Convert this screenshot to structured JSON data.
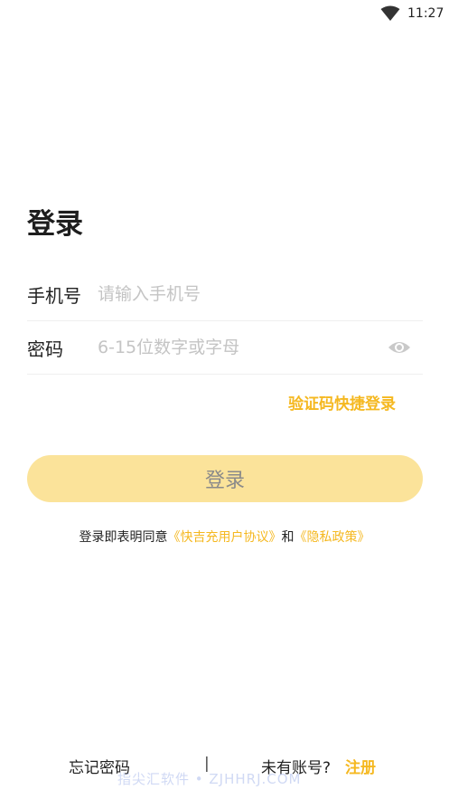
{
  "status_bar": {
    "time": "11:27"
  },
  "title": "登录",
  "phone": {
    "label": "手机号",
    "placeholder": "请输入手机号"
  },
  "password": {
    "label": "密码",
    "placeholder": "6-15位数字或字母"
  },
  "sms_login_label": "验证码快捷登录",
  "login_button_label": "登录",
  "agreement": {
    "prefix": "登录即表明同意",
    "user_agreement": "《快吉充用户协议》",
    "and": "和",
    "privacy_policy": "《隐私政策》"
  },
  "footer": {
    "forgot_password": "忘记密码",
    "divider": "|",
    "no_account": "未有账号?",
    "register": "注册"
  },
  "watermark": "指尖汇软件 • ZJHHRJ.COM",
  "colors": {
    "accent": "#f5b820",
    "button_bg": "#fbe39a",
    "button_text": "#8a8a8a"
  }
}
